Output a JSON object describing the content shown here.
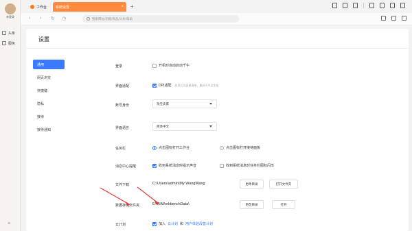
{
  "sidebar": {
    "avatar_name": "未登录",
    "items": [
      {
        "label": "头条",
        "icon": "news-icon"
      },
      {
        "label": "服务",
        "icon": "grid-icon"
      }
    ]
  },
  "tabs": [
    {
      "label": "工作台",
      "icon": "workbench-icon"
    },
    {
      "label": "系统设置",
      "active": true
    }
  ],
  "address": {
    "placeholder": "搜索网址/功能/商品/头条/帮助"
  },
  "page": {
    "title": "设置"
  },
  "menu": [
    {
      "label": "通用",
      "active": true
    },
    {
      "label": "网页浏览"
    },
    {
      "label": "快捷键"
    },
    {
      "label": "隐私"
    },
    {
      "label": "接待"
    },
    {
      "label": "接待通知"
    }
  ],
  "settings": {
    "login": {
      "label": "登录",
      "option": "开机时自动启动千牛",
      "checked": false
    },
    "display": {
      "label": "界面适配",
      "option": "DPI适配",
      "hint": "启用后页面更清晰，重启千牛后生效",
      "checked": true
    },
    "account": {
      "label": "账号身份",
      "value": "淘宝卖家"
    },
    "language": {
      "label": "界面语言",
      "value": "简体中文"
    },
    "taskbar": {
      "label": "任务栏",
      "option1": "点击图标打开工作台",
      "option2": "点击图标打开接待面板",
      "selected": 1
    },
    "notify": {
      "label": "消息中心提醒",
      "option1": "收到系统消息时提示声音",
      "option2": "收到系统消息时任务栏图标闪烁",
      "checked1": true,
      "checked2": false
    },
    "download": {
      "label": "文件下载",
      "path": "C:\\Users\\admin\\My WangWang",
      "btn1": "更改目录",
      "btn2": "打开文件夹"
    },
    "storage": {
      "label": "数据存储文件夹",
      "path": "E:\\AliWorkbenchData\\",
      "btn1": "更改目录",
      "btn2": "打开"
    },
    "cloud": {
      "label": "云计划",
      "prefix": "加入",
      "link1": "云计划",
      "middle": "和",
      "link2": "用户体验改善计划",
      "checked": true
    }
  },
  "colors": {
    "accent": "#3a7afe",
    "tab_active": "#ff8a3d",
    "annotation": "#e53935"
  }
}
